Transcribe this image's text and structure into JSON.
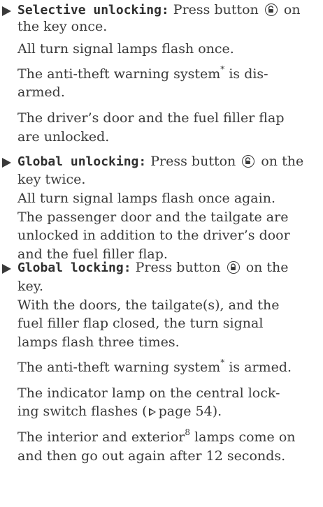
{
  "instructions": [
    {
      "title": "Selective unlocking:",
      "line1_a": " Press button",
      "line1_icon": "unlock-key-icon",
      "line1_b": " on",
      "line2": "the key once.",
      "line3": "All turn signal lamps flash once.",
      "line4_a": "The anti-theft warning system",
      "line4_star": "*",
      "line4_b": " is dis-",
      "line5": "armed.",
      "line6": "The driver’s door and the fuel filler flap",
      "line7": "are unlocked."
    },
    {
      "title": "Global unlocking:",
      "line1_a": " Press button",
      "line1_icon": "unlock-key-icon",
      "line1_b": " on the",
      "line2": "key twice.",
      "line3": "All turn signal lamps flash once again.",
      "line4": "The passenger door and the tailgate are",
      "line5": "unlocked in addition to the driver’s door",
      "line6": "and the fuel filler flap."
    },
    {
      "title": "Global locking:",
      "line1_a": " Press button",
      "line1_icon": "lock-key-icon",
      "line1_b": " on the",
      "line2": "key.",
      "line3": "With the doors, the tailgate(s), and the",
      "line4": "fuel filler flap closed, the turn signal",
      "line5": "lamps flash three times.",
      "line6_a": "The anti-theft warning system",
      "line6_star": "*",
      "line6_b": " is armed.",
      "line7": "The indicator lamp on the central lock-",
      "line8_a": "ing switch flashes (",
      "line8_ref": "page 54",
      "line8_b": ").",
      "line9_a": "The interior and exterior",
      "line9_sup": "8",
      "line9_b": " lamps come on",
      "line10": "and then go out again after 12 seconds."
    }
  ]
}
